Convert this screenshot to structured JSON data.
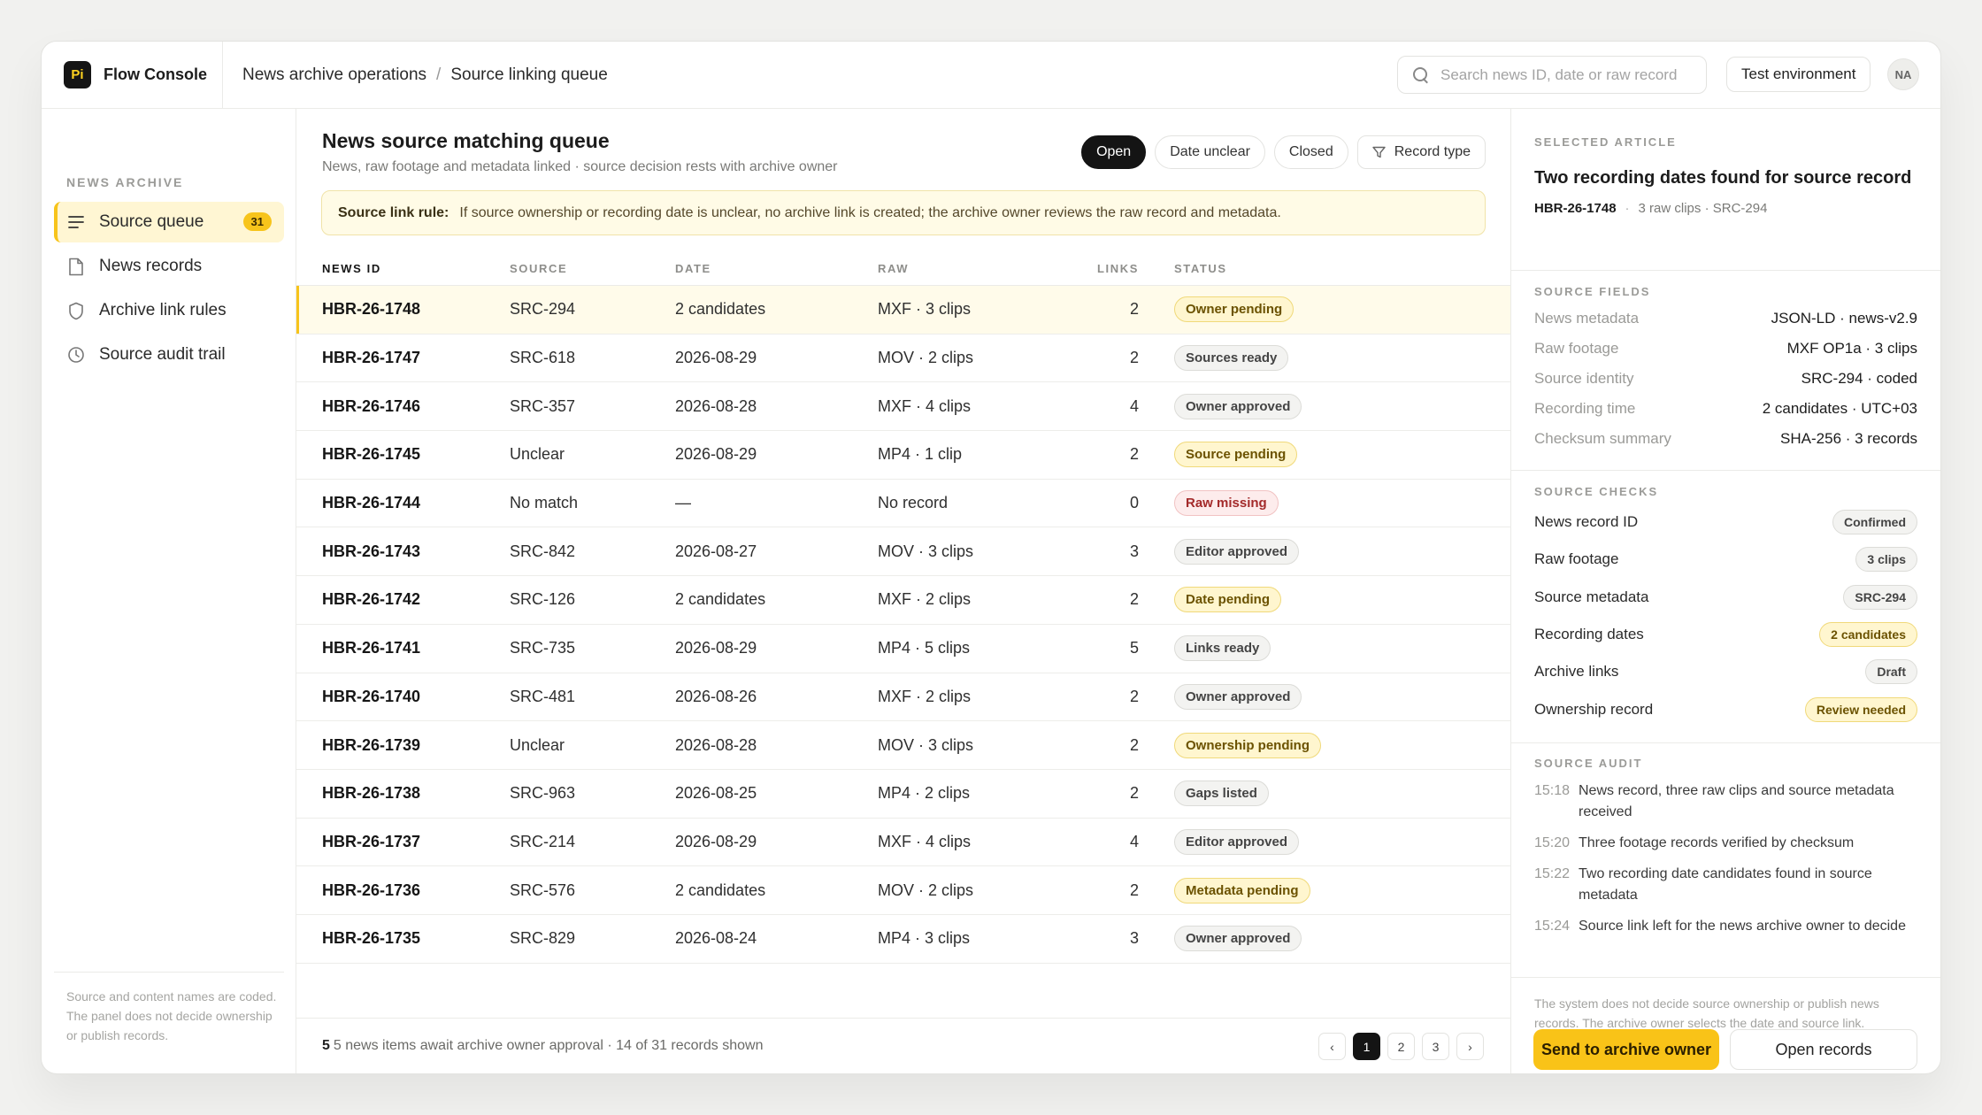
{
  "app": {
    "logo_text": "Pi",
    "name": "Flow Console"
  },
  "breadcrumb": [
    "News archive operations",
    "Source linking queue"
  ],
  "search": {
    "placeholder": "Search news ID, date or raw record",
    "value": ""
  },
  "env_button": "Test environment",
  "avatar_initials": "NA",
  "sidebar": {
    "heading": "NEWS ARCHIVE",
    "items": [
      {
        "label": "Source queue",
        "icon": "list-icon",
        "badge": "31",
        "active": true
      },
      {
        "label": "News records",
        "icon": "document-icon"
      },
      {
        "label": "Archive link rules",
        "icon": "shield-icon"
      },
      {
        "label": "Source audit trail",
        "icon": "clock-icon"
      }
    ],
    "footer": "Source and content names are coded. The panel does not decide ownership or publish records."
  },
  "main": {
    "title": "News source matching queue",
    "subtitle": "News, raw footage and metadata linked · source decision rests with archive owner",
    "filters": [
      "Open",
      "Date unclear",
      "Closed",
      "Record type"
    ],
    "rule_label": "Source link rule:",
    "rule_text": "If source ownership or recording date is unclear, no archive link is created; the archive owner reviews the raw record and metadata.",
    "columns": [
      "NEWS ID",
      "SOURCE",
      "DATE",
      "RAW",
      "LINKS",
      "STATUS"
    ],
    "rows": [
      {
        "id": "HBR-26-1748",
        "source": "SRC-294",
        "date": "2 candidates",
        "raw": "MXF · 3 clips",
        "links": "2",
        "status": "Owner pending",
        "tone": "amber"
      },
      {
        "id": "HBR-26-1747",
        "source": "SRC-618",
        "date": "2026-08-29",
        "raw": "MOV · 2 clips",
        "links": "2",
        "status": "Sources ready",
        "tone": "gray"
      },
      {
        "id": "HBR-26-1746",
        "source": "SRC-357",
        "date": "2026-08-28",
        "raw": "MXF · 4 clips",
        "links": "4",
        "status": "Owner approved",
        "tone": "gray"
      },
      {
        "id": "HBR-26-1745",
        "source": "Unclear",
        "date": "2026-08-29",
        "raw": "MP4 · 1 clip",
        "links": "2",
        "status": "Source pending",
        "tone": "amber"
      },
      {
        "id": "HBR-26-1744",
        "source": "No match",
        "date": "—",
        "raw": "No record",
        "links": "0",
        "status": "Raw missing",
        "tone": "red"
      },
      {
        "id": "HBR-26-1743",
        "source": "SRC-842",
        "date": "2026-08-27",
        "raw": "MOV · 3 clips",
        "links": "3",
        "status": "Editor approved",
        "tone": "gray"
      },
      {
        "id": "HBR-26-1742",
        "source": "SRC-126",
        "date": "2 candidates",
        "raw": "MXF · 2 clips",
        "links": "2",
        "status": "Date pending",
        "tone": "amber"
      },
      {
        "id": "HBR-26-1741",
        "source": "SRC-735",
        "date": "2026-08-29",
        "raw": "MP4 · 5 clips",
        "links": "5",
        "status": "Links ready",
        "tone": "gray"
      },
      {
        "id": "HBR-26-1740",
        "source": "SRC-481",
        "date": "2026-08-26",
        "raw": "MXF · 2 clips",
        "links": "2",
        "status": "Owner approved",
        "tone": "gray"
      },
      {
        "id": "HBR-26-1739",
        "source": "Unclear",
        "date": "2026-08-28",
        "raw": "MOV · 3 clips",
        "links": "2",
        "status": "Ownership pending",
        "tone": "amber"
      },
      {
        "id": "HBR-26-1738",
        "source": "SRC-963",
        "date": "2026-08-25",
        "raw": "MP4 · 2 clips",
        "links": "2",
        "status": "Gaps listed",
        "tone": "gray"
      },
      {
        "id": "HBR-26-1737",
        "source": "SRC-214",
        "date": "2026-08-29",
        "raw": "MXF · 4 clips",
        "links": "4",
        "status": "Editor approved",
        "tone": "gray"
      },
      {
        "id": "HBR-26-1736",
        "source": "SRC-576",
        "date": "2 candidates",
        "raw": "MOV · 2 clips",
        "links": "2",
        "status": "Metadata pending",
        "tone": "amber"
      },
      {
        "id": "HBR-26-1735",
        "source": "SRC-829",
        "date": "2026-08-24",
        "raw": "MP4 · 3 clips",
        "links": "3",
        "status": "Owner approved",
        "tone": "gray"
      }
    ],
    "footer_count": "5",
    "footer_text": "5 news items await archive owner approval · 14 of 31 records shown",
    "pager": {
      "prev": "‹",
      "pages": [
        "1",
        "2",
        "3"
      ],
      "next": "›",
      "active": "1"
    }
  },
  "panel": {
    "selected_heading": "SELECTED ARTICLE",
    "title": "Two recording dates found for source record",
    "id": "HBR-26-1748",
    "meta": "3 raw clips · SRC-294",
    "fields_heading": "SOURCE FIELDS",
    "fields": [
      {
        "k": "News metadata",
        "v": "JSON-LD · news-v2.9"
      },
      {
        "k": "Raw footage",
        "v": "MXF OP1a · 3 clips"
      },
      {
        "k": "Source identity",
        "v": "SRC-294 · coded"
      },
      {
        "k": "Recording time",
        "v": "2 candidates · UTC+03"
      },
      {
        "k": "Checksum summary",
        "v": "SHA-256 · 3 records"
      }
    ],
    "checks_heading": "SOURCE CHECKS",
    "checks": [
      {
        "k": "News record ID",
        "v": "Confirmed",
        "tone": "gray"
      },
      {
        "k": "Raw footage",
        "v": "3 clips",
        "tone": "gray"
      },
      {
        "k": "Source metadata",
        "v": "SRC-294",
        "tone": "gray"
      },
      {
        "k": "Recording dates",
        "v": "2 candidates",
        "tone": "amber"
      },
      {
        "k": "Archive links",
        "v": "Draft",
        "tone": "gray"
      },
      {
        "k": "Ownership record",
        "v": "Review needed",
        "tone": "amber"
      }
    ],
    "audit_heading": "SOURCE AUDIT",
    "audit": [
      {
        "t": "15:18",
        "text": "News record, three raw clips and source metadata received"
      },
      {
        "t": "15:20",
        "text": "Three footage records verified by checksum"
      },
      {
        "t": "15:22",
        "text": "Two recording date candidates found in source metadata"
      },
      {
        "t": "15:24",
        "text": "Source link left for the news archive owner to decide"
      }
    ],
    "note": "The system does not decide source ownership or publish news records. The archive owner selects the date and source link.",
    "primary_button": "Send to archive owner",
    "secondary_button": "Open records"
  },
  "colors": {
    "accent": "#f9c318",
    "amber_bg": "#fff6cf",
    "red_text": "#a32a2a"
  }
}
